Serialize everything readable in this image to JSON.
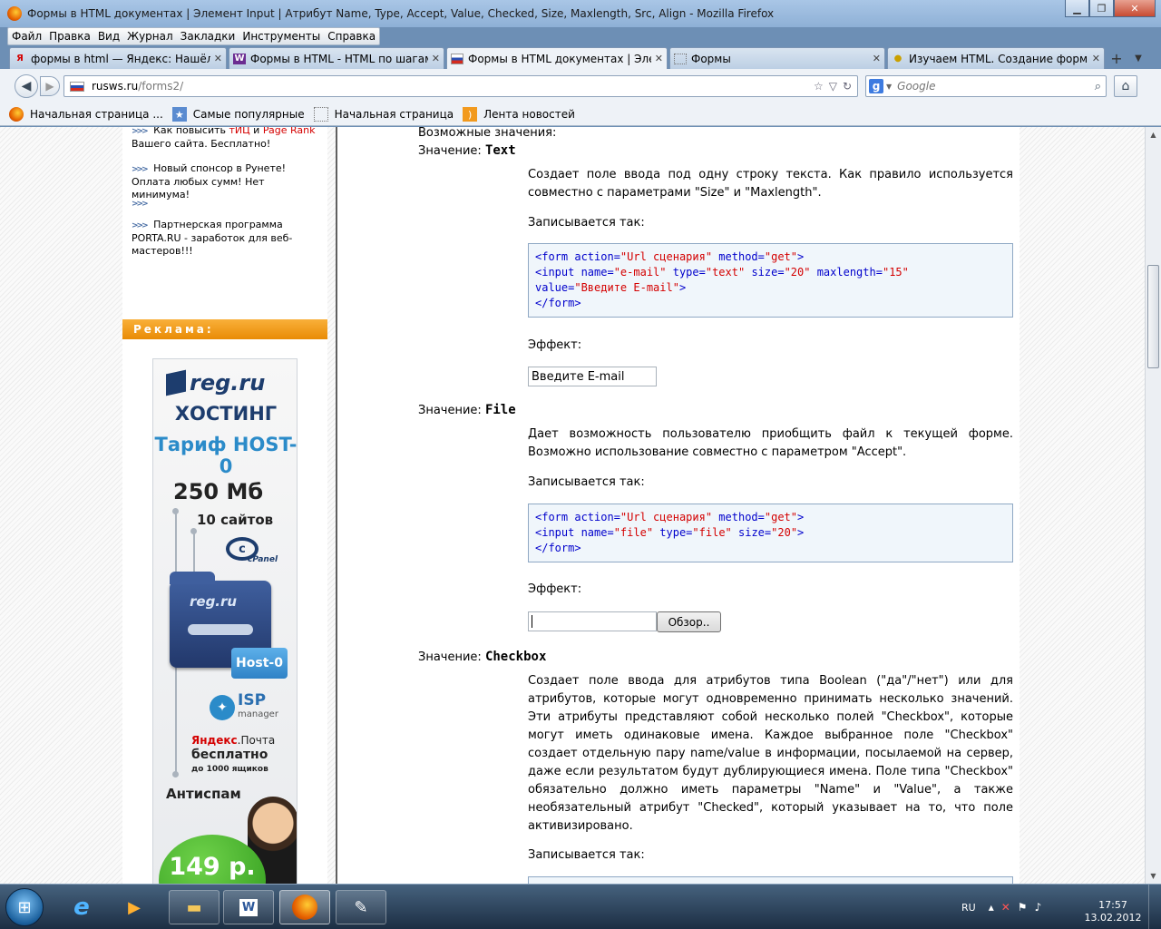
{
  "window": {
    "title": "Формы в HTML документах | Элемент Input | Атрибут Name, Type, Accept, Value, Checked, Size, Maxlength, Src, Align - Mozilla Firefox"
  },
  "menu": [
    "Файл",
    "Правка",
    "Вид",
    "Журнал",
    "Закладки",
    "Инструменты",
    "Справка"
  ],
  "tabs": [
    {
      "label": "формы в html — Яндекс: Нашёлс...",
      "favicon": "Я",
      "active": false
    },
    {
      "label": "Формы в HTML - HTML по шагам...",
      "favicon": "W",
      "active": false
    },
    {
      "label": "Формы в HTML документах | Эле...",
      "favicon": "flag",
      "active": true
    },
    {
      "label": "Формы",
      "favicon": "blank",
      "active": false
    },
    {
      "label": "Изучаем HTML. Создание форм (...",
      "favicon": "bulb",
      "active": false
    }
  ],
  "nav": {
    "url_host": "rusws.ru",
    "url_path": "/forms2/",
    "search_placeholder": "Google"
  },
  "bookmarks": [
    {
      "label": "Начальная страница ...",
      "icon": "firefox-icon"
    },
    {
      "label": "Самые популярные",
      "icon": "popular-icon"
    },
    {
      "label": "Начальная страница",
      "icon": "page-icon"
    },
    {
      "label": "Лента новостей",
      "icon": "rss-icon"
    }
  ],
  "sidebar": {
    "news": [
      {
        "pre": "Как повысить ",
        "red1": "тИЦ",
        "mid": " и ",
        "red2": "Page Rank",
        "post": " Вашего сайта. Бесплатно!"
      },
      {
        "text": "Новый спонсор в Рунете! Оплата любых сумм! Нет минимума!"
      },
      {
        "text": ""
      },
      {
        "text": "Партнерская программа PORTA.RU - заработок для веб-мастеров!!!"
      }
    ],
    "ad_header": "Реклама:",
    "banner": {
      "logo": "reg.ru",
      "hosting": "ХОСТИНГ",
      "tariff": "Тариф HOST-0",
      "space": "250 Мб",
      "sites": "10 сайтов",
      "cpanel": "cPanel",
      "folder_logo": "reg.ru",
      "host0": "Host-0",
      "isp": "ISP",
      "isp_sub": "manager",
      "yandex_brand": "Яндекс",
      "yandex_mail": ".Почта",
      "yandex_free": "бесплатно",
      "yandex_boxes": "до 1000 ящиков",
      "antispam": "Антиспам",
      "price": "149 р."
    }
  },
  "content": {
    "possible_values": "Возможные значения:",
    "value_label": "Значение:",
    "text_section": {
      "name": "Text",
      "desc": "Создает поле ввода под одну строку текста. Как правило используется совместно с параметрами \"Size\" и \"Maxlength\".",
      "written": "Записывается так:",
      "effect": "Эффект:",
      "demo_value": "Введите E-mail"
    },
    "file_section": {
      "name": "File",
      "desc": "Дает возможность пользователю приобщить файл к текущей форме. Возможно использование совместно с параметром \"Accept\".",
      "written": "Записывается так:",
      "effect": "Эффект:",
      "browse": "Обзор.."
    },
    "checkbox_section": {
      "name": "Checkbox",
      "desc": "Создает поле ввода для атрибутов типа Boolean (\"да\"/\"нет\") или для атрибутов, которые могут одновременно принимать несколько значений. Эти атрибуты представляют собой несколько полей \"Checkbox\", которые могут иметь одинаковые имена. Каждое выбранное поле \"Checkbox\" создает отдельную пару name/value в информации, посылаемой на сервер, даже если результатом будут дублирующиеся имена. Поле типа \"Checkbox\" обязательно должно иметь параметры \"Name\" и \"Value\", а также необязательный атрибут \"Checked\", который указывает на то, что поле активизировано.",
      "written": "Записывается так:"
    }
  },
  "taskbar": {
    "lang": "RU",
    "time": "17:57",
    "date": "13.02.2012"
  }
}
